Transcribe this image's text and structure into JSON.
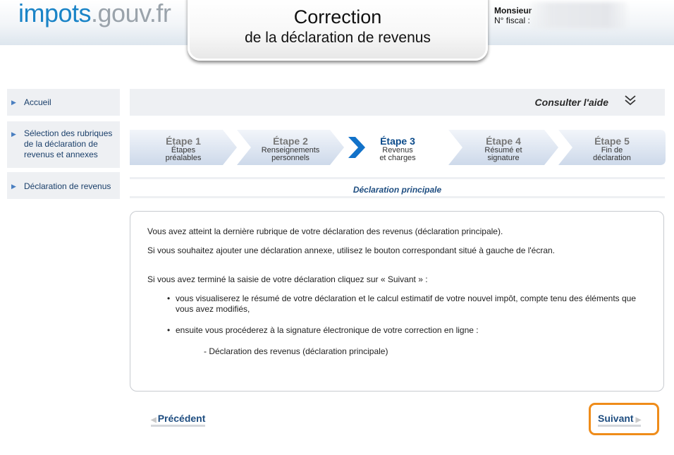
{
  "header": {
    "logo_part1": "impots",
    "logo_part2": ".gouv.fr",
    "title_line1": "Correction",
    "title_line2": "de la déclaration de revenus",
    "user_name": "Monsieur",
    "fiscal_label": "N° fiscal :"
  },
  "sidebar": {
    "items": [
      {
        "label": "Accueil"
      },
      {
        "label": "Sélection des rubriques de la déclaration de revenus et annexes"
      },
      {
        "label": "Déclaration de revenus"
      }
    ]
  },
  "help": {
    "label": "Consulter l'aide",
    "icon": "double-chevron-down-icon"
  },
  "steps": [
    {
      "title": "Étape 1",
      "desc1": "Étapes",
      "desc2": "préalables"
    },
    {
      "title": "Étape 2",
      "desc1": "Renseignements",
      "desc2": "personnels"
    },
    {
      "title": "Étape 3",
      "desc1": "Revenus",
      "desc2": "et charges",
      "active": true
    },
    {
      "title": "Étape 4",
      "desc1": "Résumé et",
      "desc2": "signature"
    },
    {
      "title": "Étape 5",
      "desc1": "Fin de",
      "desc2": "déclaration"
    }
  ],
  "section_title": "Déclaration principale",
  "content": {
    "p1": "Vous avez atteint la dernière rubrique de votre déclaration des revenus (déclaration principale).",
    "p2": "Si vous souhaitez ajouter une déclaration annexe, utilisez le bouton correspondant situé à gauche de l'écran.",
    "p3": "Si vous avez terminé la saisie de votre déclaration cliquez sur « Suivant » :",
    "bullet1": "vous visualiserez le résumé de votre déclaration et le calcul estimatif de votre nouvel impôt, compte tenu des éléments que vous avez modifiés,",
    "bullet2": "ensuite vous procéderez à la signature électronique de votre correction en ligne :",
    "sub": "- Déclaration des revenus (déclaration principale)"
  },
  "nav": {
    "prev_label": "Précédent",
    "next_label": "Suivant"
  },
  "colors": {
    "accent": "#1a84c7",
    "highlight": "#ef8c1a",
    "link": "#1e4d80"
  }
}
